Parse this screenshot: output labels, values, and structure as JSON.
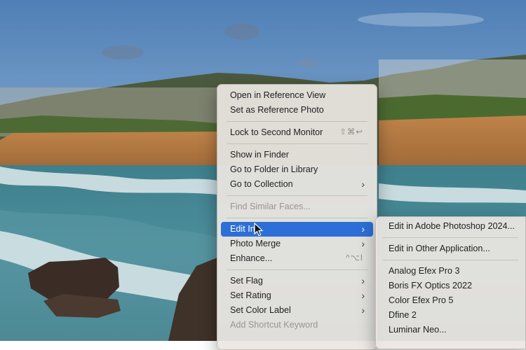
{
  "context_menu": {
    "groups": [
      [
        {
          "label": "Open in Reference View"
        },
        {
          "label": "Set as Reference Photo"
        }
      ],
      [
        {
          "label": "Lock to Second Monitor",
          "shortcut": "⇧⌘↩"
        }
      ],
      [
        {
          "label": "Show in Finder"
        },
        {
          "label": "Go to Folder in Library"
        },
        {
          "label": "Go to Collection",
          "submenu_icon": "chevron-right-icon"
        }
      ],
      [
        {
          "label": "Find Similar Faces...",
          "disabled": true
        }
      ],
      [
        {
          "label": "Edit In",
          "submenu_icon": "chevron-right-icon",
          "highlighted": true
        },
        {
          "label": "Photo Merge",
          "submenu_icon": "chevron-right-icon"
        },
        {
          "label": "Enhance...",
          "shortcut": "^⌥I"
        }
      ],
      [
        {
          "label": "Set Flag",
          "submenu_icon": "chevron-right-icon"
        },
        {
          "label": "Set Rating",
          "submenu_icon": "chevron-right-icon"
        },
        {
          "label": "Set Color Label",
          "submenu_icon": "chevron-right-icon"
        },
        {
          "label": "Add Shortcut Keyword",
          "disabled": true
        }
      ]
    ]
  },
  "edit_in_submenu": {
    "groups": [
      [
        {
          "label": "Edit in Adobe Photoshop 2024..."
        }
      ],
      [
        {
          "label": "Edit in Other Application..."
        }
      ],
      [
        {
          "label": "Analog Efex Pro 3"
        },
        {
          "label": "Boris FX Optics 2022"
        },
        {
          "label": "Color Efex Pro 5"
        },
        {
          "label": "Dfine 2"
        },
        {
          "label": "Luminar Neo..."
        }
      ]
    ]
  },
  "colors": {
    "highlight": "#2d6fd6",
    "menu_background": "#ece6e2",
    "disabled_text": "#9a9592"
  }
}
